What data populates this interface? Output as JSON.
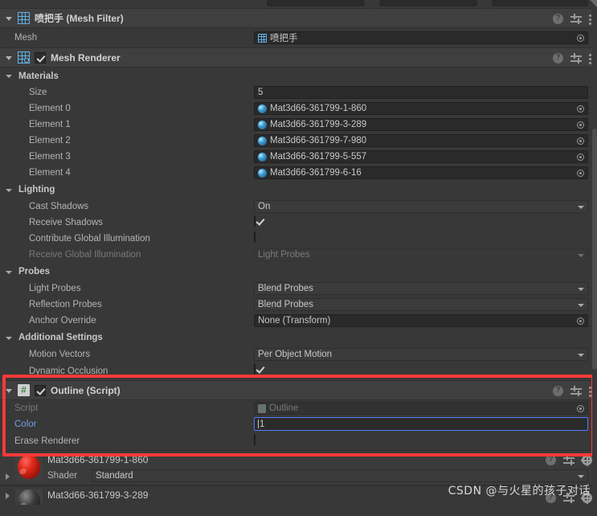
{
  "components": [
    {
      "id": "mesh-filter",
      "title_cn": "喷把手",
      "title_en": " (Mesh Filter)",
      "icon": "mesh-grid-icon",
      "rows": [
        {
          "label": "Mesh",
          "type": "object",
          "value": "喷把手",
          "icon": "mesh-grid-icon"
        }
      ]
    },
    {
      "id": "mesh-renderer",
      "title_cn": "",
      "title_en": "Mesh Renderer",
      "icon": "mesh-renderer-icon",
      "enabled": true,
      "sections": [
        {
          "name": "Materials",
          "rows": [
            {
              "label": "Size",
              "type": "number",
              "value": "5"
            },
            {
              "label": "Element 0",
              "type": "material",
              "value": "Mat3d66-361799-1-860"
            },
            {
              "label": "Element 1",
              "type": "material",
              "value": "Mat3d66-361799-3-289"
            },
            {
              "label": "Element 2",
              "type": "material",
              "value": "Mat3d66-361799-7-980"
            },
            {
              "label": "Element 3",
              "type": "material",
              "value": "Mat3d66-361799-5-557"
            },
            {
              "label": "Element 4",
              "type": "material",
              "value": "Mat3d66-361799-6-16"
            }
          ]
        },
        {
          "name": "Lighting",
          "rows": [
            {
              "label": "Cast Shadows",
              "type": "dropdown",
              "value": "On"
            },
            {
              "label": "Receive Shadows",
              "type": "checkbox",
              "value": true
            },
            {
              "label": "Contribute Global Illumination",
              "type": "checkbox",
              "value": false
            },
            {
              "label": "Receive Global Illumination",
              "type": "dropdown",
              "value": "Light Probes",
              "disabled": true
            }
          ]
        },
        {
          "name": "Probes",
          "rows": [
            {
              "label": "Light Probes",
              "type": "dropdown",
              "value": "Blend Probes"
            },
            {
              "label": "Reflection Probes",
              "type": "dropdown",
              "value": "Blend Probes"
            },
            {
              "label": "Anchor Override",
              "type": "object",
              "value": "None (Transform)"
            }
          ]
        },
        {
          "name": "Additional Settings",
          "rows": [
            {
              "label": "Motion Vectors",
              "type": "dropdown",
              "value": "Per Object Motion"
            },
            {
              "label": "Dynamic Occlusion",
              "type": "checkbox",
              "value": true
            }
          ]
        }
      ]
    },
    {
      "id": "outline-script",
      "title_en": "Outline (Script)",
      "icon": "csharp-script-icon",
      "enabled": true,
      "highlighted": true,
      "rows": [
        {
          "label": "Script",
          "type": "object",
          "value": "Outline",
          "disabled": true
        },
        {
          "label": "Color",
          "type": "number",
          "value": "1",
          "focused": true,
          "modified": true
        },
        {
          "label": "Erase Renderer",
          "type": "checkbox",
          "value": false
        }
      ]
    }
  ],
  "materials": [
    {
      "name": "Mat3d66-361799-1-860",
      "shader_label": "Shader",
      "shader_value": "Standard"
    },
    {
      "name": "Mat3d66-361799-3-289"
    }
  ],
  "watermark": "CSDN @与火星的孩子对话",
  "colors": {
    "highlight_border": "#f63a38",
    "modified_label": "#6f9ee6",
    "focus_border": "#4c7eff",
    "icon_blue": "#5fb2e8",
    "script_green": "#3d8b50"
  }
}
